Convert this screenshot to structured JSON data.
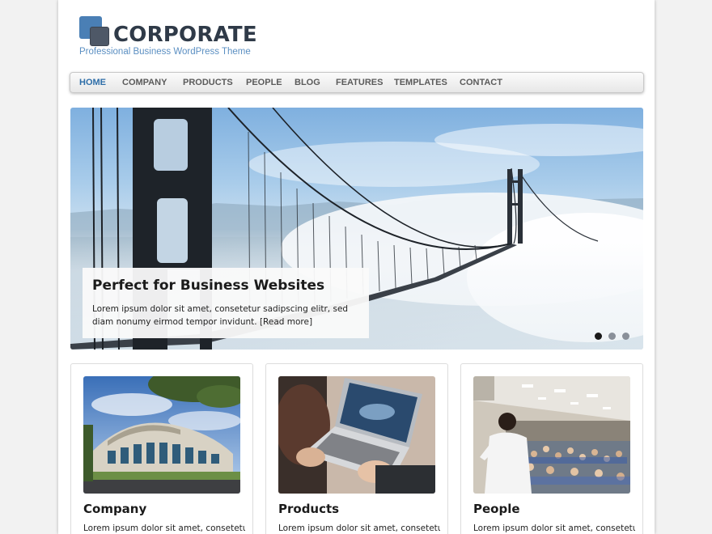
{
  "site": {
    "title": "CORPORATE",
    "tagline": "Professional Business WordPress Theme"
  },
  "nav": {
    "items": [
      {
        "label": "HOME",
        "active": true
      },
      {
        "label": "COMPANY"
      },
      {
        "label": "PRODUCTS"
      },
      {
        "label": "PEOPLE"
      },
      {
        "label": "BLOG"
      },
      {
        "label": "FEATURES"
      },
      {
        "label": "TEMPLATES"
      },
      {
        "label": "CONTACT"
      }
    ]
  },
  "slider": {
    "title": "Perfect for Business Websites",
    "text": "Lorem ipsum dolor sit amet, consetetur sadipscing elitr, sed diam nonumy eirmod tempor invidunt.",
    "link": "[Read more]",
    "slide_count": 3,
    "active_slide": 1
  },
  "features": [
    {
      "title": "Company",
      "text": "Lorem ipsum dolor sit amet, consetetur"
    },
    {
      "title": "Products",
      "text": "Lorem ipsum dolor sit amet, consetetur"
    },
    {
      "title": "People",
      "text": "Lorem ipsum dolor sit amet, consetetur"
    }
  ],
  "colors": {
    "accent": "#2e6ea8",
    "tagline": "#5b8fc2",
    "logo_primary": "#4a7fb5",
    "logo_secondary": "#4e5867"
  }
}
